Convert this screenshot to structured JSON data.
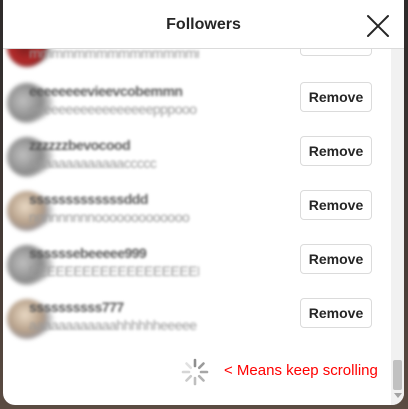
{
  "dialog": {
    "title": "Followers"
  },
  "followers": [
    {
      "username": "sssssssssssssssssssss",
      "full_name": "mmmmmmmmmmmmmmmmmm",
      "remove_label": "Remove"
    },
    {
      "username": "eeeeeeeevieevcobemmn",
      "full_name": "eeeeeeeeeeeeeeeeepppooo",
      "remove_label": "Remove"
    },
    {
      "username": "zzzzzzbevocood",
      "full_name": "aaaaaaaaaaaaaccccc",
      "remove_label": "Remove"
    },
    {
      "username": "sssssssssssssddd",
      "full_name": "nnnnnnnnnooooooooooooo",
      "remove_label": "Remove"
    },
    {
      "username": "ssssssebeeeee999",
      "full_name": "EEEEEEEEEEEEEEEEEEEE",
      "remove_label": "Remove"
    },
    {
      "username": "ssssssssss777",
      "full_name": "aaaaaaaaaaaahhhhhheeeee",
      "remove_label": "Remove"
    }
  ],
  "loading": {
    "annotation": "< Means keep scrolling",
    "annotation_color": "#ff0000"
  },
  "icons": {
    "close": "close-icon",
    "spinner": "loading-spinner-icon"
  }
}
